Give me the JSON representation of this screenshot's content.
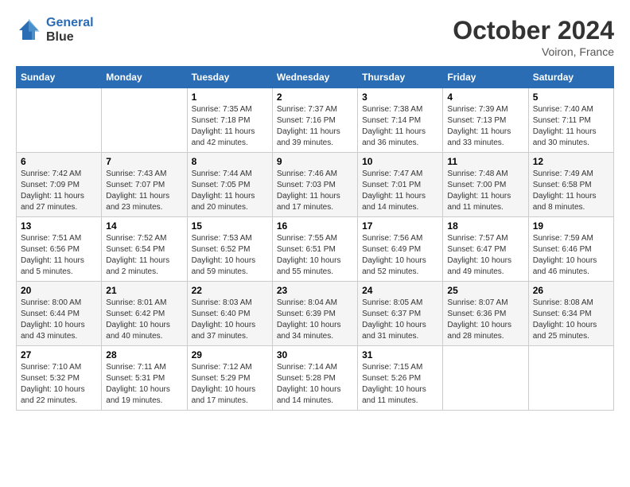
{
  "header": {
    "logo_line1": "General",
    "logo_line2": "Blue",
    "month": "October 2024",
    "location": "Voiron, France"
  },
  "weekdays": [
    "Sunday",
    "Monday",
    "Tuesday",
    "Wednesday",
    "Thursday",
    "Friday",
    "Saturday"
  ],
  "weeks": [
    [
      {
        "day": "",
        "info": ""
      },
      {
        "day": "",
        "info": ""
      },
      {
        "day": "1",
        "info": "Sunrise: 7:35 AM\nSunset: 7:18 PM\nDaylight: 11 hours and 42 minutes."
      },
      {
        "day": "2",
        "info": "Sunrise: 7:37 AM\nSunset: 7:16 PM\nDaylight: 11 hours and 39 minutes."
      },
      {
        "day": "3",
        "info": "Sunrise: 7:38 AM\nSunset: 7:14 PM\nDaylight: 11 hours and 36 minutes."
      },
      {
        "day": "4",
        "info": "Sunrise: 7:39 AM\nSunset: 7:13 PM\nDaylight: 11 hours and 33 minutes."
      },
      {
        "day": "5",
        "info": "Sunrise: 7:40 AM\nSunset: 7:11 PM\nDaylight: 11 hours and 30 minutes."
      }
    ],
    [
      {
        "day": "6",
        "info": "Sunrise: 7:42 AM\nSunset: 7:09 PM\nDaylight: 11 hours and 27 minutes."
      },
      {
        "day": "7",
        "info": "Sunrise: 7:43 AM\nSunset: 7:07 PM\nDaylight: 11 hours and 23 minutes."
      },
      {
        "day": "8",
        "info": "Sunrise: 7:44 AM\nSunset: 7:05 PM\nDaylight: 11 hours and 20 minutes."
      },
      {
        "day": "9",
        "info": "Sunrise: 7:46 AM\nSunset: 7:03 PM\nDaylight: 11 hours and 17 minutes."
      },
      {
        "day": "10",
        "info": "Sunrise: 7:47 AM\nSunset: 7:01 PM\nDaylight: 11 hours and 14 minutes."
      },
      {
        "day": "11",
        "info": "Sunrise: 7:48 AM\nSunset: 7:00 PM\nDaylight: 11 hours and 11 minutes."
      },
      {
        "day": "12",
        "info": "Sunrise: 7:49 AM\nSunset: 6:58 PM\nDaylight: 11 hours and 8 minutes."
      }
    ],
    [
      {
        "day": "13",
        "info": "Sunrise: 7:51 AM\nSunset: 6:56 PM\nDaylight: 11 hours and 5 minutes."
      },
      {
        "day": "14",
        "info": "Sunrise: 7:52 AM\nSunset: 6:54 PM\nDaylight: 11 hours and 2 minutes."
      },
      {
        "day": "15",
        "info": "Sunrise: 7:53 AM\nSunset: 6:52 PM\nDaylight: 10 hours and 59 minutes."
      },
      {
        "day": "16",
        "info": "Sunrise: 7:55 AM\nSunset: 6:51 PM\nDaylight: 10 hours and 55 minutes."
      },
      {
        "day": "17",
        "info": "Sunrise: 7:56 AM\nSunset: 6:49 PM\nDaylight: 10 hours and 52 minutes."
      },
      {
        "day": "18",
        "info": "Sunrise: 7:57 AM\nSunset: 6:47 PM\nDaylight: 10 hours and 49 minutes."
      },
      {
        "day": "19",
        "info": "Sunrise: 7:59 AM\nSunset: 6:46 PM\nDaylight: 10 hours and 46 minutes."
      }
    ],
    [
      {
        "day": "20",
        "info": "Sunrise: 8:00 AM\nSunset: 6:44 PM\nDaylight: 10 hours and 43 minutes."
      },
      {
        "day": "21",
        "info": "Sunrise: 8:01 AM\nSunset: 6:42 PM\nDaylight: 10 hours and 40 minutes."
      },
      {
        "day": "22",
        "info": "Sunrise: 8:03 AM\nSunset: 6:40 PM\nDaylight: 10 hours and 37 minutes."
      },
      {
        "day": "23",
        "info": "Sunrise: 8:04 AM\nSunset: 6:39 PM\nDaylight: 10 hours and 34 minutes."
      },
      {
        "day": "24",
        "info": "Sunrise: 8:05 AM\nSunset: 6:37 PM\nDaylight: 10 hours and 31 minutes."
      },
      {
        "day": "25",
        "info": "Sunrise: 8:07 AM\nSunset: 6:36 PM\nDaylight: 10 hours and 28 minutes."
      },
      {
        "day": "26",
        "info": "Sunrise: 8:08 AM\nSunset: 6:34 PM\nDaylight: 10 hours and 25 minutes."
      }
    ],
    [
      {
        "day": "27",
        "info": "Sunrise: 7:10 AM\nSunset: 5:32 PM\nDaylight: 10 hours and 22 minutes."
      },
      {
        "day": "28",
        "info": "Sunrise: 7:11 AM\nSunset: 5:31 PM\nDaylight: 10 hours and 19 minutes."
      },
      {
        "day": "29",
        "info": "Sunrise: 7:12 AM\nSunset: 5:29 PM\nDaylight: 10 hours and 17 minutes."
      },
      {
        "day": "30",
        "info": "Sunrise: 7:14 AM\nSunset: 5:28 PM\nDaylight: 10 hours and 14 minutes."
      },
      {
        "day": "31",
        "info": "Sunrise: 7:15 AM\nSunset: 5:26 PM\nDaylight: 10 hours and 11 minutes."
      },
      {
        "day": "",
        "info": ""
      },
      {
        "day": "",
        "info": ""
      }
    ]
  ]
}
